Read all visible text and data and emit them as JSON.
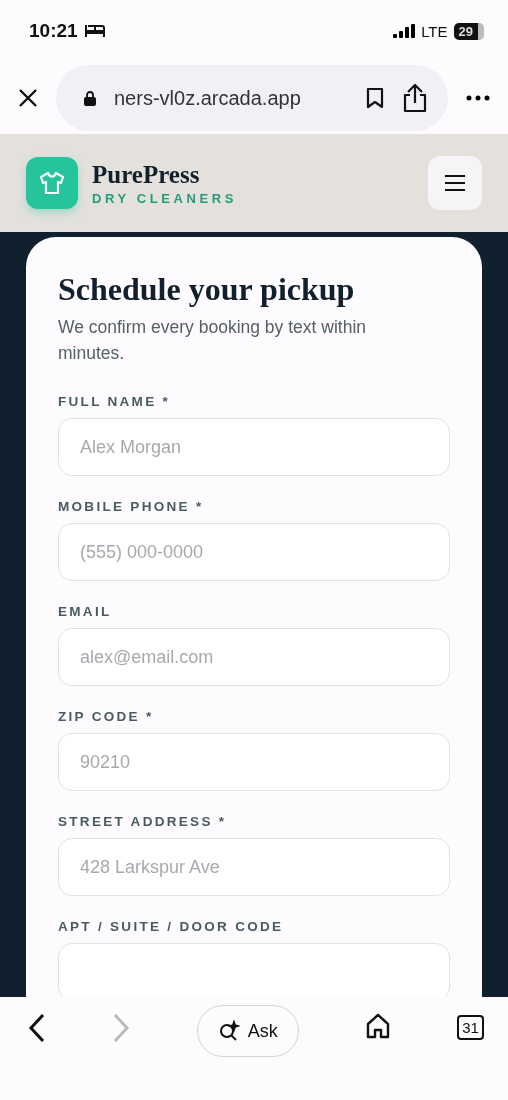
{
  "status_bar": {
    "time": "10:21",
    "network": "LTE",
    "battery": "29"
  },
  "browser": {
    "url": "ners-vl0z.arcada.app"
  },
  "header": {
    "brand": "PurePress",
    "tagline": "DRY CLEANERS"
  },
  "form": {
    "title": "Schedule your pickup",
    "subtitle": "We confirm every booking by text within minutes.",
    "fields": [
      {
        "label": "FULL NAME *",
        "placeholder": "Alex Morgan"
      },
      {
        "label": "MOBILE PHONE *",
        "placeholder": "(555) 000-0000"
      },
      {
        "label": "EMAIL",
        "placeholder": "alex@email.com"
      },
      {
        "label": "ZIP CODE *",
        "placeholder": "90210"
      },
      {
        "label": "STREET ADDRESS *",
        "placeholder": "428 Larkspur Ave"
      },
      {
        "label": "APT / SUITE / DOOR CODE"
      }
    ]
  },
  "toolbar": {
    "back_disabled": false,
    "forward_disabled": true,
    "ask": "Ask",
    "tabs": "31"
  }
}
